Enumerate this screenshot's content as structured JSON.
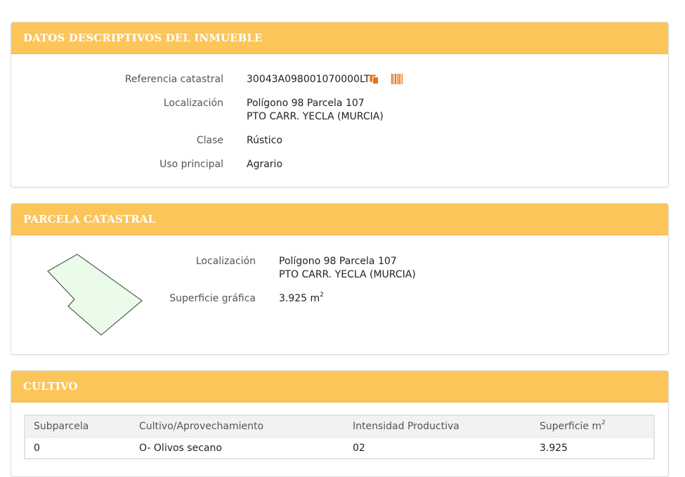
{
  "panel1": {
    "title": "DATOS DESCRIPTIVOS DEL INMUEBLE",
    "referencia_label": "Referencia catastral",
    "referencia_value": "30043A098001070000LT",
    "localizacion_label": "Localización",
    "localizacion_line1": "Polígono 98 Parcela 107",
    "localizacion_line2": "PTO CARR. YECLA (MURCIA)",
    "clase_label": "Clase",
    "clase_value": "Rústico",
    "uso_label": "Uso principal",
    "uso_value": "Agrario"
  },
  "panel2": {
    "title": "PARCELA CATASTRAL",
    "localizacion_label": "Localización",
    "localizacion_line1": "Polígono 98 Parcela 107",
    "localizacion_line2": "PTO CARR. YECLA (MURCIA)",
    "superficie_label": "Superficie gráfica",
    "superficie_value": "3.925 m",
    "superficie_unit_sup": "2"
  },
  "panel3": {
    "title": "CULTIVO",
    "headers": [
      "Subparcela",
      "Cultivo/Aprovechamiento",
      "Intensidad Productiva",
      "Superficie m"
    ],
    "header_sup": "2",
    "rows": [
      [
        "0",
        "O- Olivos secano",
        "02",
        "3.925"
      ]
    ]
  },
  "icons": {
    "copy": "copy-icon",
    "barcode": "barcode-icon"
  },
  "colors": {
    "header_bg": "#fcc55a",
    "header_text": "#ffffff",
    "icon_orange": "#e8731a",
    "parcel_fill": "#eafbea"
  }
}
